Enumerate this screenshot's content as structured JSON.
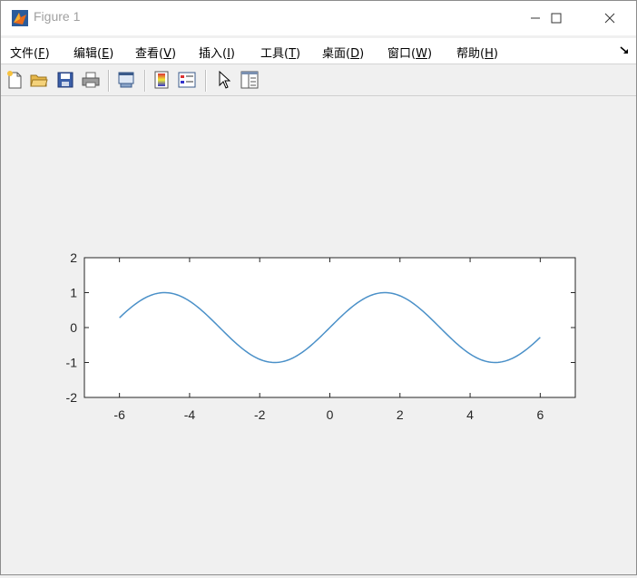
{
  "window": {
    "title": "Figure 1",
    "minimize_symbol": "—",
    "maximize_symbol": "☐",
    "close_symbol": "✕"
  },
  "menu": {
    "items": [
      {
        "label": "文件(",
        "key": "F",
        "tail": ")"
      },
      {
        "label": "编辑(",
        "key": "E",
        "tail": ")"
      },
      {
        "label": "查看(",
        "key": "V",
        "tail": ")"
      },
      {
        "label": "插入(",
        "key": "I",
        "tail": ")"
      },
      {
        "label": "工具(",
        "key": "T",
        "tail": ")"
      },
      {
        "label": "桌面(",
        "key": "D",
        "tail": ")"
      },
      {
        "label": "窗口(",
        "key": "W",
        "tail": ")"
      },
      {
        "label": "帮助(",
        "key": "H",
        "tail": ")"
      }
    ],
    "dock_icon": "dock-arrow-icon"
  },
  "toolbar": {
    "icons": [
      "new-figure-icon",
      "open-file-icon",
      "save-icon",
      "print-icon",
      "link-plot-icon",
      "colorbar-icon",
      "legend-icon",
      "pointer-icon",
      "property-editor-icon"
    ]
  },
  "chart_data": {
    "type": "line",
    "function": "sin(x)",
    "x_range": [
      -6,
      6
    ],
    "xlim": [
      -7,
      7
    ],
    "ylim": [
      -2,
      2
    ],
    "x_ticks": [
      "-6",
      "-4",
      "-2",
      "0",
      "2",
      "4",
      "6"
    ],
    "y_ticks": [
      "2",
      "1",
      "0",
      "-1",
      "-2"
    ],
    "series": [
      {
        "color": "#4a90c8",
        "x": [
          -6,
          -5,
          -4,
          -3,
          -2,
          -1,
          0,
          1,
          2,
          3,
          4,
          5,
          6
        ],
        "y": [
          0.279,
          0.959,
          0.757,
          -0.141,
          -0.909,
          -0.841,
          0,
          0.841,
          0.909,
          0.141,
          -0.757,
          -0.959,
          -0.279
        ]
      }
    ],
    "title": "",
    "xlabel": "",
    "ylabel": "",
    "grid": false
  }
}
